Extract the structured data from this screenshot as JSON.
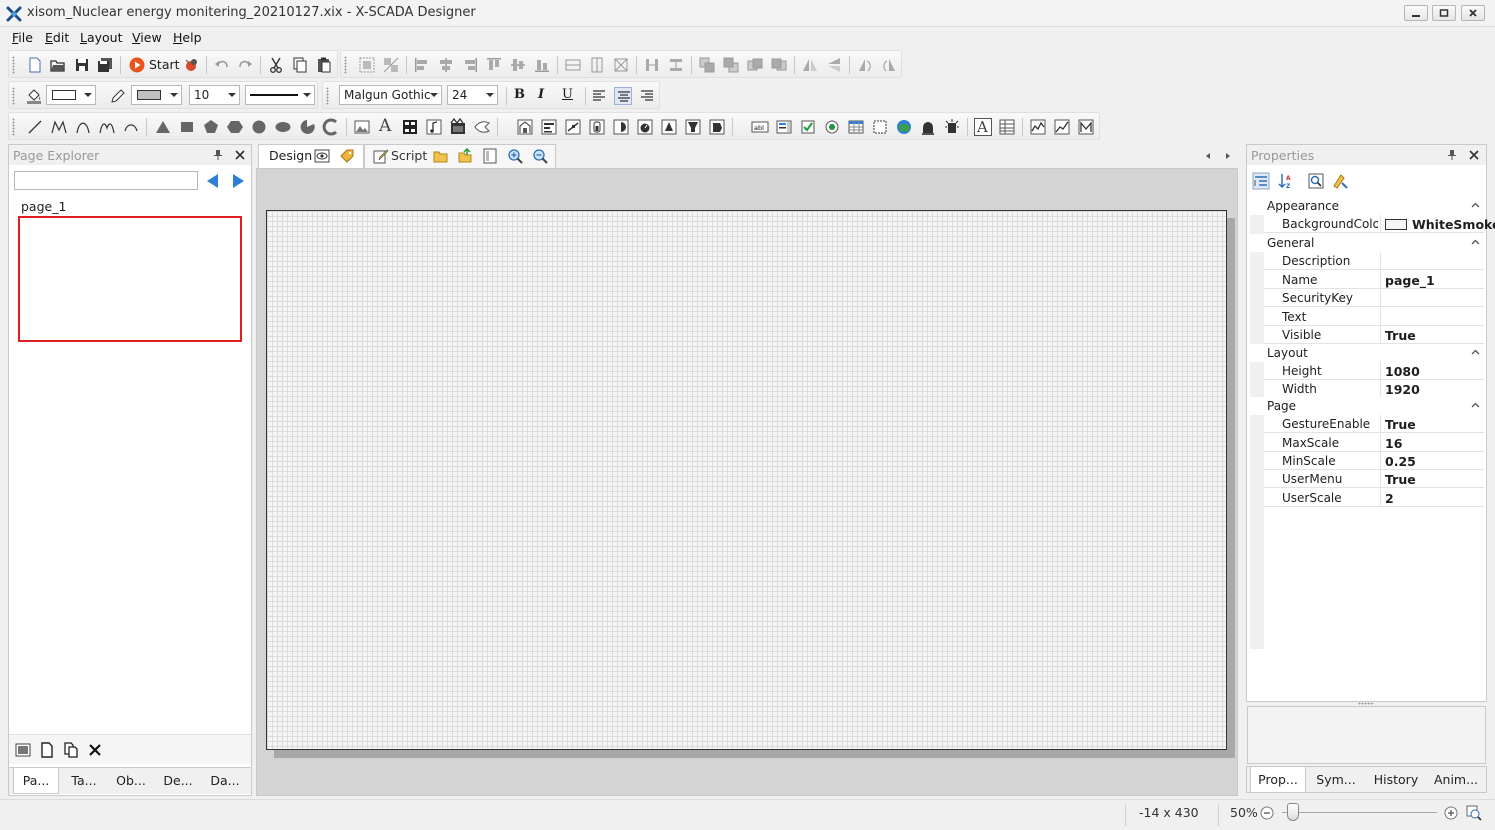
{
  "window": {
    "title": "xisom_Nuclear energy monitering_20210127.xix - X-SCADA Designer"
  },
  "menu": [
    "File",
    "Edit",
    "Layout",
    "View",
    "Help"
  ],
  "toolbar1": {
    "start_label": "Start"
  },
  "toolbar2": {
    "font_size": "10",
    "font_family": "Malgun Gothic",
    "text_size": "24",
    "bold": "B",
    "italic": "I",
    "underline": "U"
  },
  "toolbar3": {
    "text_tool": "A",
    "text_tool2": "A",
    "label_tool": "abl"
  },
  "page_explorer": {
    "title": "Page Explorer",
    "search_value": "",
    "pages": [
      "page_1"
    ],
    "tabs": [
      "Pa...",
      "Ta...",
      "Ob...",
      "De...",
      "Da..."
    ]
  },
  "document": {
    "tabs": [
      "Design",
      "Script"
    ]
  },
  "properties": {
    "title": "Properties",
    "categories": [
      {
        "name": "Appearance",
        "rows": [
          {
            "name": "BackgroundColo",
            "value": "WhiteSmoke"
          }
        ]
      },
      {
        "name": "General",
        "rows": [
          {
            "name": "Description",
            "value": ""
          },
          {
            "name": "Name",
            "value": "page_1"
          },
          {
            "name": "SecurityKey",
            "value": ""
          },
          {
            "name": "Text",
            "value": ""
          },
          {
            "name": "Visible",
            "value": "True"
          }
        ]
      },
      {
        "name": "Layout",
        "rows": [
          {
            "name": "Height",
            "value": "1080"
          },
          {
            "name": "Width",
            "value": "1920"
          }
        ]
      },
      {
        "name": "Page",
        "rows": [
          {
            "name": "GestureEnable",
            "value": "True"
          },
          {
            "name": "MaxScale",
            "value": "16"
          },
          {
            "name": "MinScale",
            "value": "0.25"
          },
          {
            "name": "UserMenu",
            "value": "True"
          },
          {
            "name": "UserScale",
            "value": "2"
          }
        ]
      }
    ],
    "tabs": [
      "Prop...",
      "Sym...",
      "History",
      "Anim..."
    ]
  },
  "status": {
    "coords": "-14 x 430",
    "zoom": "50%",
    "zoom_level": 0.5
  },
  "colors": {
    "selection_border": "#e02020",
    "accent_blue": "#2f7fd8",
    "start_orange": "#e8541e"
  }
}
